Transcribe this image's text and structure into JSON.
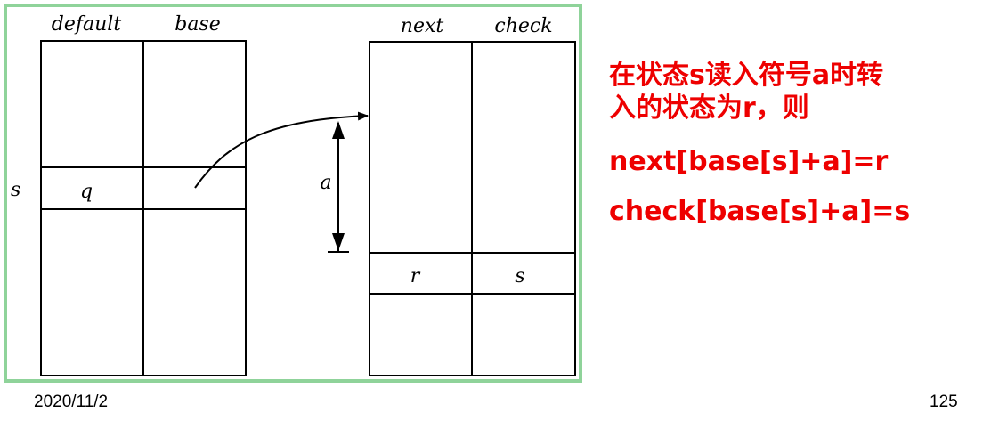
{
  "left_table": {
    "headers": [
      "default",
      "base"
    ],
    "row_label": "s",
    "cell_default": "q",
    "cell_base": ""
  },
  "right_table": {
    "headers": [
      "next",
      "check"
    ],
    "cell_next": "r",
    "cell_check": "s"
  },
  "offset_label": "a",
  "explanation": {
    "line1": "在状态s读入符号a时转",
    "line2": "入的状态为r，则",
    "eq1": "next[base[s]+a]=r",
    "eq2": "check[base[s]+a]=s"
  },
  "footer": {
    "date": "2020/11/2",
    "page": "125"
  },
  "colors": {
    "frame_border": "#8fd39a",
    "text_red": "#ee0000"
  }
}
